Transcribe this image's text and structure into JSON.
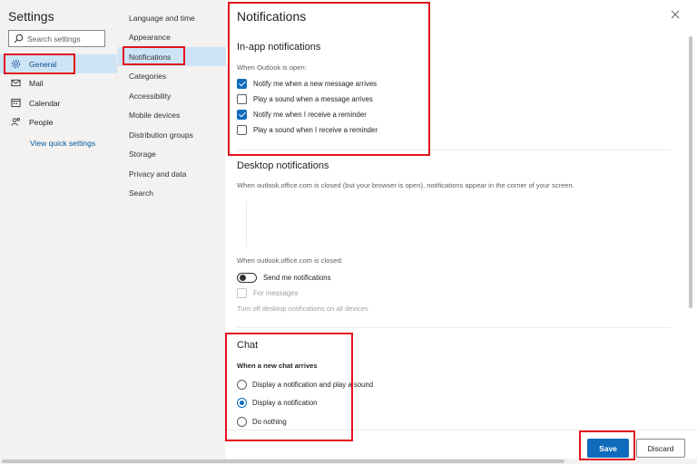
{
  "app": {
    "title": "Settings"
  },
  "search": {
    "placeholder": "Search settings"
  },
  "nav": {
    "items": [
      {
        "label": "General",
        "icon": "gear-icon"
      },
      {
        "label": "Mail",
        "icon": "mail-icon"
      },
      {
        "label": "Calendar",
        "icon": "calendar-icon"
      },
      {
        "label": "People",
        "icon": "people-icon"
      }
    ],
    "quick_settings": "View quick settings"
  },
  "subnav": {
    "items": [
      "Language and time",
      "Appearance",
      "Notifications",
      "Categories",
      "Accessibility",
      "Mobile devices",
      "Distribution groups",
      "Storage",
      "Privacy and data",
      "Search"
    ]
  },
  "panel": {
    "title": "Notifications",
    "inapp": {
      "heading": "In-app notifications",
      "sub": "When Outlook is open:",
      "options": [
        {
          "label": "Notify me when a new message arrives",
          "checked": true
        },
        {
          "label": "Play a sound when a message arrives",
          "checked": false
        },
        {
          "label": "Notify me when I receive a reminder",
          "checked": true
        },
        {
          "label": "Play a sound when I receive a reminder",
          "checked": false
        }
      ]
    },
    "desktop": {
      "heading": "Desktop notifications",
      "sub": "When outlook.office.com is closed (but your browser is open), notifications appear in the corner of your screen.",
      "closed_label": "When outlook.office.com is closed:",
      "toggle_label": "Send me notifications",
      "for_messages": "For messages",
      "turn_off": "Turn off desktop notifications on all devices"
    },
    "chat": {
      "heading": "Chat",
      "sub": "When a new chat arrives",
      "options": [
        {
          "label": "Display a notification and play a sound",
          "selected": false
        },
        {
          "label": "Display a notification",
          "selected": true
        },
        {
          "label": "Do nothing",
          "selected": false
        }
      ]
    }
  },
  "footer": {
    "save": "Save",
    "discard": "Discard"
  },
  "colors": {
    "accent": "#0f6cbd",
    "annotation": "#e3141e",
    "selected_bg": "#cde4f7"
  }
}
